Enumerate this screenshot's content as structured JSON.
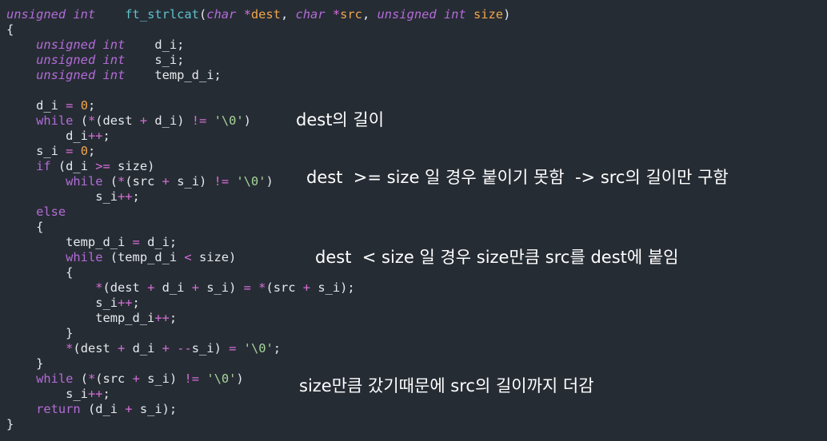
{
  "code": {
    "lines": [
      [
        [
          "unsigned int",
          "type"
        ],
        [
          "    ",
          "punc"
        ],
        [
          "ft_strlcat",
          "func"
        ],
        [
          "(",
          "punc"
        ],
        [
          "char",
          "type"
        ],
        [
          " ",
          "punc"
        ],
        [
          "*",
          "op"
        ],
        [
          "dest",
          "param"
        ],
        [
          ", ",
          "punc"
        ],
        [
          "char",
          "type"
        ],
        [
          " ",
          "punc"
        ],
        [
          "*",
          "op"
        ],
        [
          "src",
          "param"
        ],
        [
          ", ",
          "punc"
        ],
        [
          "unsigned int",
          "type"
        ],
        [
          " ",
          "punc"
        ],
        [
          "size",
          "param"
        ],
        [
          ")",
          "punc"
        ]
      ],
      [
        [
          "{",
          "punc"
        ]
      ],
      [
        [
          "    ",
          "punc"
        ],
        [
          "unsigned int",
          "type"
        ],
        [
          "    d_i;",
          "punc"
        ]
      ],
      [
        [
          "    ",
          "punc"
        ],
        [
          "unsigned int",
          "type"
        ],
        [
          "    s_i;",
          "punc"
        ]
      ],
      [
        [
          "    ",
          "punc"
        ],
        [
          "unsigned int",
          "type"
        ],
        [
          "    temp_d_i;",
          "punc"
        ]
      ],
      [],
      [
        [
          "    d_i ",
          "punc"
        ],
        [
          "=",
          "op"
        ],
        [
          " ",
          "punc"
        ],
        [
          "0",
          "num"
        ],
        [
          ";",
          "punc"
        ]
      ],
      [
        [
          "    ",
          "punc"
        ],
        [
          "while",
          "kw"
        ],
        [
          " (",
          "punc"
        ],
        [
          "*",
          "op"
        ],
        [
          "(dest ",
          "punc"
        ],
        [
          "+",
          "op"
        ],
        [
          " d_i) ",
          "punc"
        ],
        [
          "!=",
          "op"
        ],
        [
          " ",
          "punc"
        ],
        [
          "'\\0'",
          "str"
        ],
        [
          ")",
          "punc"
        ]
      ],
      [
        [
          "        d_i",
          "punc"
        ],
        [
          "++",
          "op"
        ],
        [
          ";",
          "punc"
        ]
      ],
      [
        [
          "    s_i ",
          "punc"
        ],
        [
          "=",
          "op"
        ],
        [
          " ",
          "punc"
        ],
        [
          "0",
          "num"
        ],
        [
          ";",
          "punc"
        ]
      ],
      [
        [
          "    ",
          "punc"
        ],
        [
          "if",
          "kw"
        ],
        [
          " (d_i ",
          "punc"
        ],
        [
          ">=",
          "op"
        ],
        [
          " size)",
          "punc"
        ]
      ],
      [
        [
          "        ",
          "punc"
        ],
        [
          "while",
          "kw"
        ],
        [
          " (",
          "punc"
        ],
        [
          "*",
          "op"
        ],
        [
          "(src ",
          "punc"
        ],
        [
          "+",
          "op"
        ],
        [
          " s_i) ",
          "punc"
        ],
        [
          "!=",
          "op"
        ],
        [
          " ",
          "punc"
        ],
        [
          "'\\0'",
          "str"
        ],
        [
          ")",
          "punc"
        ]
      ],
      [
        [
          "            s_i",
          "punc"
        ],
        [
          "++",
          "op"
        ],
        [
          ";",
          "punc"
        ]
      ],
      [
        [
          "    ",
          "punc"
        ],
        [
          "else",
          "kw"
        ]
      ],
      [
        [
          "    {",
          "punc"
        ]
      ],
      [
        [
          "        temp_d_i ",
          "punc"
        ],
        [
          "=",
          "op"
        ],
        [
          " d_i;",
          "punc"
        ]
      ],
      [
        [
          "        ",
          "punc"
        ],
        [
          "while",
          "kw"
        ],
        [
          " (temp_d_i ",
          "punc"
        ],
        [
          "<",
          "op"
        ],
        [
          " size)",
          "punc"
        ]
      ],
      [
        [
          "        {",
          "punc"
        ]
      ],
      [
        [
          "            ",
          "punc"
        ],
        [
          "*",
          "op"
        ],
        [
          "(dest ",
          "punc"
        ],
        [
          "+",
          "op"
        ],
        [
          " d_i ",
          "punc"
        ],
        [
          "+",
          "op"
        ],
        [
          " s_i) ",
          "punc"
        ],
        [
          "=",
          "op"
        ],
        [
          " ",
          "punc"
        ],
        [
          "*",
          "op"
        ],
        [
          "(src ",
          "punc"
        ],
        [
          "+",
          "op"
        ],
        [
          " s_i);",
          "punc"
        ]
      ],
      [
        [
          "            s_i",
          "punc"
        ],
        [
          "++",
          "op"
        ],
        [
          ";",
          "punc"
        ]
      ],
      [
        [
          "            temp_d_i",
          "punc"
        ],
        [
          "++",
          "op"
        ],
        [
          ";",
          "punc"
        ]
      ],
      [
        [
          "        }",
          "punc"
        ]
      ],
      [
        [
          "        ",
          "punc"
        ],
        [
          "*",
          "op"
        ],
        [
          "(dest ",
          "punc"
        ],
        [
          "+",
          "op"
        ],
        [
          " d_i ",
          "punc"
        ],
        [
          "+",
          "op"
        ],
        [
          " ",
          "punc"
        ],
        [
          "--",
          "op"
        ],
        [
          "s_i) ",
          "punc"
        ],
        [
          "=",
          "op"
        ],
        [
          " ",
          "punc"
        ],
        [
          "'\\0'",
          "str"
        ],
        [
          ";",
          "punc"
        ]
      ],
      [
        [
          "    }",
          "punc"
        ]
      ],
      [
        [
          "    ",
          "punc"
        ],
        [
          "while",
          "kw"
        ],
        [
          " (",
          "punc"
        ],
        [
          "*",
          "op"
        ],
        [
          "(src ",
          "punc"
        ],
        [
          "+",
          "op"
        ],
        [
          " s_i) ",
          "punc"
        ],
        [
          "!=",
          "op"
        ],
        [
          " ",
          "punc"
        ],
        [
          "'\\0'",
          "str"
        ],
        [
          ")",
          "punc"
        ]
      ],
      [
        [
          "        s_i",
          "punc"
        ],
        [
          "++",
          "op"
        ],
        [
          ";",
          "punc"
        ]
      ],
      [
        [
          "    ",
          "punc"
        ],
        [
          "return",
          "kw"
        ],
        [
          " (d_i ",
          "punc"
        ],
        [
          "+",
          "op"
        ],
        [
          " s_i);",
          "punc"
        ]
      ],
      [
        [
          "}",
          "punc"
        ]
      ]
    ]
  },
  "annotations": {
    "dest_length": "dest의 길이",
    "size_exceeded": "dest  >= size 일 경우 붙이기 못함  -> src의 길이만 구함",
    "size_within": "dest  < size 일 경우 size만큼 src를 dest에 붙임",
    "remaining_length": "size만큼 갔기때문에 src의 길이까지 더감"
  },
  "colors": {
    "background": "#262c34",
    "type": "#b36cd8",
    "function": "#5ec2cd",
    "parameter": "#f2a64a",
    "operator": "#d46ed6",
    "string": "#a7d59a",
    "text": "#e6e9ee"
  }
}
